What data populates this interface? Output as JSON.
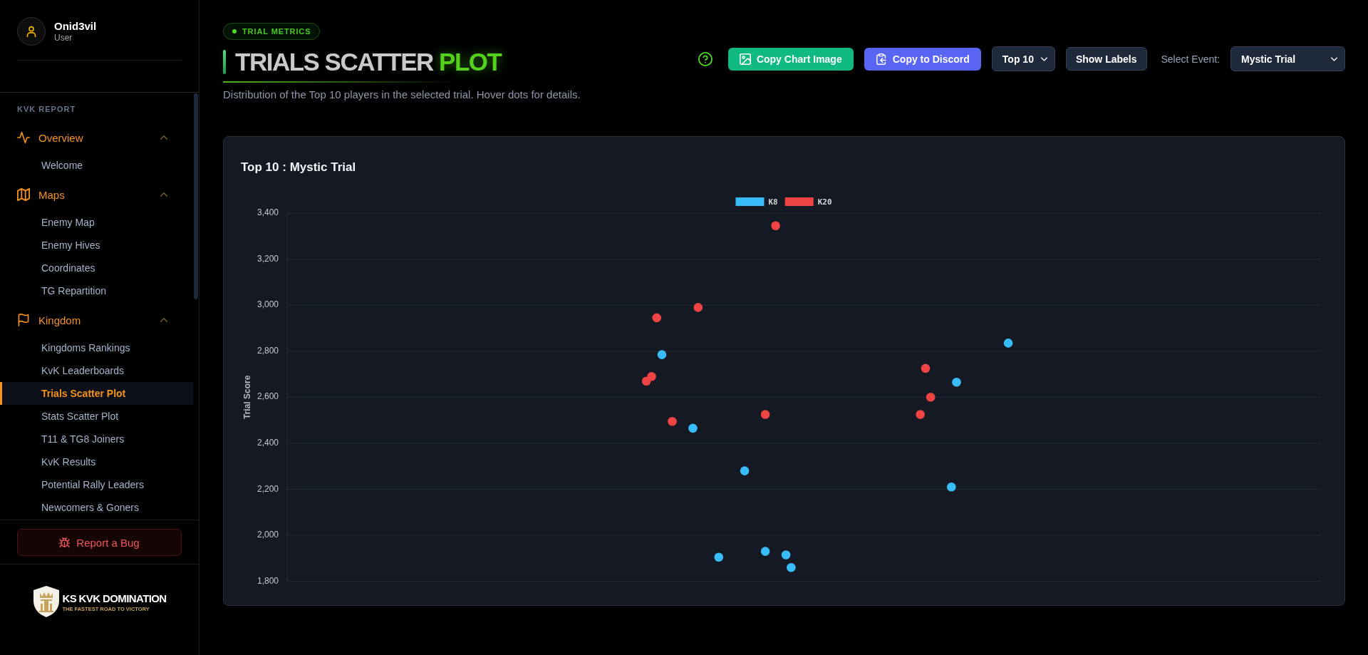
{
  "sidebar": {
    "user": {
      "name": "Onid3vil",
      "role": "User"
    },
    "section_label": "KVK REPORT",
    "groups": [
      {
        "label": "Overview",
        "expanded": true,
        "items": [
          {
            "label": "Welcome",
            "selected": false
          }
        ]
      },
      {
        "label": "Maps",
        "expanded": true,
        "items": [
          {
            "label": "Enemy Map",
            "selected": false
          },
          {
            "label": "Enemy Hives",
            "selected": false
          },
          {
            "label": "Coordinates",
            "selected": false
          },
          {
            "label": "TG Repartition",
            "selected": false
          }
        ]
      },
      {
        "label": "Kingdom",
        "expanded": true,
        "items": [
          {
            "label": "Kingdoms Rankings",
            "selected": false
          },
          {
            "label": "KvK Leaderboards",
            "selected": false
          },
          {
            "label": "Trials Scatter Plot",
            "selected": true
          },
          {
            "label": "Stats Scatter Plot",
            "selected": false
          },
          {
            "label": "T11 & TG8 Joiners",
            "selected": false
          },
          {
            "label": "KvK Results",
            "selected": false
          },
          {
            "label": "Potential Rally Leaders",
            "selected": false
          },
          {
            "label": "Newcomers & Goners",
            "selected": false
          }
        ]
      }
    ],
    "report_button": "Report a Bug",
    "logo": {
      "title": "KS KVK DOMINATION",
      "tagline": "THE FASTEST ROAD TO VICTORY"
    }
  },
  "header": {
    "badge": "TRIAL METRICS",
    "title": "TRIALS SCATTER",
    "title_accent": "PLOT",
    "description": "Distribution of the Top 10 players in the selected trial. Hover dots for details."
  },
  "toolbar": {
    "copy_image_button": "Copy Chart Image",
    "copy_discord_button": "Copy to Discord",
    "top_select": "Top 10",
    "labels_button": "Show Labels",
    "event_label": "Select Event:",
    "event_select": "Mystic Trial"
  },
  "chart_card": {
    "chart_data": {
      "type": "scatter",
      "title": "Top 10 : Mystic Trial",
      "ylabel": "Trial Score",
      "grid": "y",
      "legend": "top",
      "ylim": [
        1800,
        3400
      ],
      "yticks": [
        {
          "value": 1800,
          "label": "1,800"
        },
        {
          "value": 2000,
          "label": "2,000"
        },
        {
          "value": 2200,
          "label": "2,200"
        },
        {
          "value": 2400,
          "label": "2,400"
        },
        {
          "value": 2600,
          "label": "2,600"
        },
        {
          "value": 2800,
          "label": "2,800"
        },
        {
          "value": 3000,
          "label": "3,000"
        },
        {
          "value": 3200,
          "label": "3,200"
        },
        {
          "value": 3400,
          "label": "3,400"
        }
      ],
      "categories": [
        null,
        null,
        null,
        null,
        null,
        null,
        null,
        null,
        null,
        null,
        null,
        null,
        null,
        null,
        null,
        null,
        null,
        null,
        null,
        null,
        null,
        null,
        null,
        null,
        null,
        null,
        null,
        null,
        null,
        null,
        null,
        null,
        null,
        null,
        null,
        null,
        null,
        null,
        null,
        null,
        null,
        null,
        null,
        null,
        null,
        null,
        null,
        null,
        null,
        null,
        null,
        null,
        null,
        null,
        null,
        null,
        null,
        null,
        null,
        null,
        null,
        null,
        null,
        null,
        null,
        null,
        null,
        null,
        null,
        null,
        null,
        null,
        null,
        null,
        null,
        null,
        null,
        null,
        null,
        null,
        null,
        null,
        null,
        null,
        null,
        null,
        null,
        null,
        null,
        null,
        null,
        null,
        null,
        null,
        null,
        null,
        null,
        null,
        null,
        null,
        null,
        null,
        null,
        null,
        null,
        null,
        null,
        null,
        null,
        null,
        null,
        null,
        null,
        null,
        null,
        null,
        null,
        null,
        null,
        null,
        null,
        null,
        null,
        null,
        null,
        null,
        null,
        null,
        null,
        null,
        null,
        null,
        null,
        null,
        null,
        null,
        null,
        null,
        null,
        null,
        null,
        null,
        null,
        null,
        null,
        null,
        null,
        null,
        null,
        null,
        null,
        null,
        null,
        null,
        null,
        null,
        null,
        null,
        null,
        null,
        null,
        null,
        null,
        null,
        null,
        null,
        null,
        null,
        null,
        null,
        null,
        null,
        null,
        null,
        null,
        null,
        null,
        null,
        null,
        null,
        null,
        null,
        null,
        null,
        null,
        null,
        null,
        null,
        null,
        null,
        null,
        null,
        null,
        null,
        null,
        null,
        null,
        null,
        null,
        null
      ],
      "series": [
        {
          "name": "K8",
          "color": "#38bdf8",
          "values": [
            null,
            null,
            null,
            null,
            null,
            null,
            null,
            null,
            null,
            null,
            null,
            null,
            null,
            null,
            null,
            null,
            null,
            null,
            null,
            null,
            null,
            null,
            null,
            null,
            null,
            null,
            null,
            null,
            null,
            null,
            null,
            null,
            null,
            null,
            null,
            null,
            null,
            null,
            null,
            null,
            null,
            null,
            null,
            null,
            null,
            null,
            null,
            null,
            null,
            null,
            null,
            null,
            null,
            null,
            null,
            null,
            null,
            null,
            null,
            null,
            null,
            null,
            null,
            null,
            null,
            null,
            null,
            null,
            null,
            null,
            null,
            null,
            2785,
            null,
            null,
            null,
            null,
            null,
            2465,
            null,
            null,
            null,
            null,
            1905,
            null,
            null,
            null,
            null,
            2280,
            null,
            null,
            null,
            1930,
            null,
            null,
            null,
            1915,
            1860,
            null,
            null,
            null,
            null,
            null,
            null,
            null,
            null,
            null,
            null,
            null,
            null,
            null,
            null,
            null,
            null,
            null,
            null,
            null,
            null,
            null,
            null,
            null,
            null,
            null,
            null,
            null,
            null,
            null,
            null,
            2210,
            2665,
            null,
            null,
            null,
            null,
            null,
            null,
            null,
            null,
            null,
            2835,
            null,
            null,
            null,
            null,
            null,
            null,
            null,
            null,
            null,
            null,
            null,
            null,
            null,
            null,
            null,
            null,
            null,
            null,
            null,
            null,
            null,
            null,
            null,
            null,
            null,
            null,
            null,
            null,
            null,
            null,
            null,
            null,
            null,
            null,
            null,
            null,
            null,
            null,
            null,
            null,
            null,
            null,
            null,
            null,
            null,
            null,
            null,
            null,
            null,
            null,
            null,
            null,
            null,
            null,
            null,
            null,
            null,
            null,
            null,
            null
          ]
        },
        {
          "name": "K20",
          "color": "#ef4444",
          "values": [
            null,
            null,
            null,
            null,
            null,
            null,
            null,
            null,
            null,
            null,
            null,
            null,
            null,
            null,
            null,
            null,
            null,
            null,
            null,
            null,
            null,
            null,
            null,
            null,
            null,
            null,
            null,
            null,
            null,
            null,
            null,
            null,
            null,
            null,
            null,
            null,
            null,
            null,
            null,
            null,
            null,
            null,
            null,
            null,
            null,
            null,
            null,
            null,
            null,
            null,
            null,
            null,
            null,
            null,
            null,
            null,
            null,
            null,
            null,
            null,
            null,
            null,
            null,
            null,
            null,
            null,
            null,
            null,
            null,
            2670,
            2690,
            2945,
            null,
            null,
            2495,
            null,
            null,
            null,
            null,
            2990,
            null,
            null,
            null,
            null,
            null,
            null,
            null,
            null,
            null,
            null,
            null,
            null,
            2525,
            null,
            3345,
            null,
            null,
            null,
            null,
            null,
            null,
            null,
            null,
            null,
            null,
            null,
            null,
            null,
            null,
            null,
            null,
            null,
            null,
            null,
            null,
            null,
            null,
            null,
            null,
            null,
            null,
            null,
            2525,
            2725,
            2600,
            null,
            null,
            null,
            null,
            null,
            null,
            null,
            null,
            null,
            null,
            null,
            null,
            null,
            null,
            null,
            null,
            null,
            null,
            null,
            null,
            null,
            null,
            null,
            null,
            null,
            null,
            null,
            null,
            null,
            null,
            null,
            null,
            null,
            null,
            null,
            null,
            null,
            null,
            null,
            null,
            null,
            null,
            null,
            null,
            null,
            null,
            null,
            null,
            null,
            null,
            null,
            null,
            null,
            null,
            null,
            null,
            null,
            null,
            null,
            null,
            null,
            null,
            null,
            null,
            null,
            null,
            null,
            null,
            null,
            null,
            null,
            null,
            null,
            null,
            null
          ]
        }
      ]
    }
  }
}
